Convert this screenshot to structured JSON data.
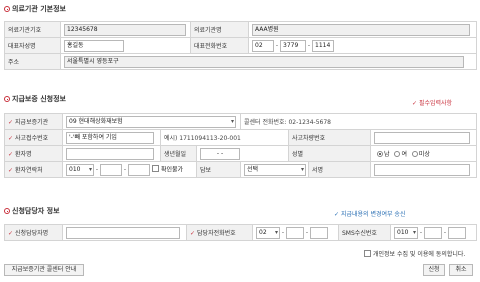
{
  "institution_section": {
    "title": "의료기관 기본정보",
    "code_label": "의료기관기호",
    "code_value": "12345678",
    "name_label": "의료기관명",
    "name_value": "AAA병원",
    "rep_name_label": "대표자성명",
    "rep_name_value": "홍길동",
    "rep_phone_label": "대표전화번호",
    "rep_phone": [
      "02",
      "3779",
      "1114"
    ],
    "address_label": "주소",
    "address_value": "서울특별시 영등포구"
  },
  "guarantee_section": {
    "title": "지급보증 신청정보",
    "required_note": "필수입력사항",
    "org_label": "지급보증기관",
    "org_value": "09 현대해상화재보험",
    "call_center_text": "콜센터 전화번호: 02-1234-5678",
    "receipt_label": "사고접수번호",
    "receipt_value": "'-'빼 포함하여 기입",
    "receipt_example": "예시) 1711094113-20-001",
    "vehicle_label": "사고차량번호",
    "vehicle_value": "",
    "patient_label": "환자명",
    "patient_value": "",
    "birth_label": "생년월일",
    "birth_value": "- -",
    "gender_label": "성별",
    "gender_options": [
      "남",
      "여",
      "미상"
    ],
    "gender_selected": "남",
    "contact_label": "환자연락처",
    "contact_prefix": "010",
    "unknown_label": "확인불가",
    "insurer_rep_label": "담보",
    "insurer_rep_value": "선택",
    "sign_label": "서명"
  },
  "applicant_section": {
    "title": "신청담당자 정보",
    "note": "지급내용의 변경여부 송신",
    "name_label": "신청담당자명",
    "name_value": "",
    "direct_phone_label": "담당자전화번호",
    "direct_phone_prefix": "02",
    "sms_label": "SMS수신번호",
    "sms_prefix": "010",
    "consent_label": "개인정보 수집 및 이용에 동의합니다."
  },
  "footer": {
    "call_center_button": "지급보증기관 콜센터 안내",
    "apply_button": "신청",
    "cancel_button": "취소"
  },
  "colors": {
    "accent_red": "#c9303c",
    "accent_blue": "#2a6fb4",
    "label_bg": "#f1f1f1",
    "border": "#d4d4d4"
  }
}
